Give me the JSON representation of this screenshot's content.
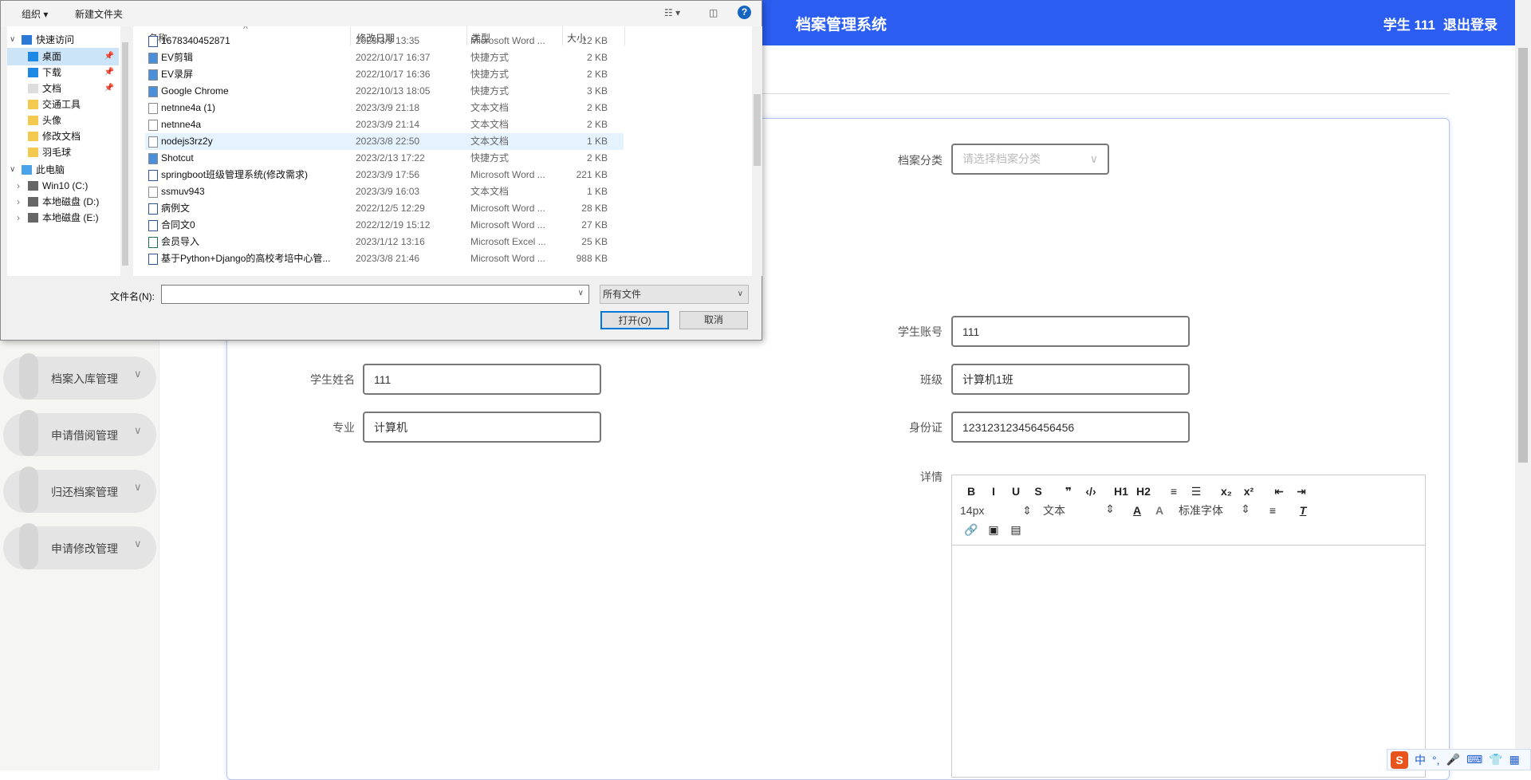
{
  "header": {
    "title": "档案管理系统",
    "user": "学生 111",
    "logout": "退出登录"
  },
  "sidebar": {
    "items": [
      {
        "label": "档案入库管理"
      },
      {
        "label": "申请借阅管理"
      },
      {
        "label": "归还档案管理"
      },
      {
        "label": "申请修改管理"
      }
    ]
  },
  "form": {
    "category": {
      "label": "档案分类",
      "placeholder": "请选择档案分类"
    },
    "account": {
      "label": "学生账号",
      "value": "111"
    },
    "name": {
      "label": "学生姓名",
      "value": "111"
    },
    "class": {
      "label": "班级",
      "value": "计算机1班"
    },
    "major": {
      "label": "专业",
      "value": "计算机"
    },
    "idcard": {
      "label": "身份证",
      "value": "123123123456456456"
    },
    "detail": {
      "label": "详情"
    }
  },
  "editor": {
    "row1": [
      "B",
      "I",
      "U",
      "S",
      "❞",
      "‹/›",
      "H1",
      "H2",
      "≡",
      "☰",
      "x₂",
      "x²",
      "⇤",
      "⇥"
    ],
    "size": "14px",
    "header": "文本",
    "font": "标准字体",
    "row3": [
      "🔗",
      "▣",
      "▤"
    ]
  },
  "dialog": {
    "organize": "组织 ▾",
    "new_folder": "新建文件夹",
    "nav": [
      {
        "label": "快速访问",
        "icon": "star-icon"
      },
      {
        "label": "桌面",
        "icon": "desktop-icon",
        "pinned": true
      },
      {
        "label": "下载",
        "icon": "download-icon",
        "pinned": true
      },
      {
        "label": "文档",
        "icon": "document-icon",
        "pinned": true
      },
      {
        "label": "交通工具",
        "icon": "folder-icon"
      },
      {
        "label": "头像",
        "icon": "folder-icon"
      },
      {
        "label": "修改文档",
        "icon": "folder-icon"
      },
      {
        "label": "羽毛球",
        "icon": "folder-icon"
      },
      {
        "label": "此电脑",
        "icon": "computer-icon"
      },
      {
        "label": "Win10 (C:)",
        "icon": "drive-icon"
      },
      {
        "label": "本地磁盘 (D:)",
        "icon": "drive-icon"
      },
      {
        "label": "本地磁盘 (E:)",
        "icon": "drive-icon"
      }
    ],
    "columns": [
      "名称",
      "修改日期",
      "类型",
      "大小"
    ],
    "files": [
      [
        "1678340452871",
        "2023/3/9 13:35",
        "Microsoft Word ...",
        "12 KB"
      ],
      [
        "EV剪辑",
        "2022/10/17 16:37",
        "快捷方式",
        "2 KB"
      ],
      [
        "EV录屏",
        "2022/10/17 16:36",
        "快捷方式",
        "2 KB"
      ],
      [
        "Google Chrome",
        "2022/10/13 18:05",
        "快捷方式",
        "3 KB"
      ],
      [
        "netnne4a (1)",
        "2023/3/9 21:18",
        "文本文档",
        "2 KB"
      ],
      [
        "netnne4a",
        "2023/3/9 21:14",
        "文本文档",
        "2 KB"
      ],
      [
        "nodejs3rz2y",
        "2023/3/8 22:50",
        "文本文档",
        "1 KB"
      ],
      [
        "Shotcut",
        "2023/2/13 17:22",
        "快捷方式",
        "2 KB"
      ],
      [
        "springboot班级管理系统(修改需求)",
        "2023/3/9 17:56",
        "Microsoft Word ...",
        "221 KB"
      ],
      [
        "ssmuv943",
        "2023/3/9 16:03",
        "文本文档",
        "1 KB"
      ],
      [
        "病例文",
        "2022/12/5 12:29",
        "Microsoft Word ...",
        "28 KB"
      ],
      [
        "合同文0",
        "2022/12/19 15:12",
        "Microsoft Word ...",
        "27 KB"
      ],
      [
        "会员导入",
        "2023/1/12 13:16",
        "Microsoft Excel ...",
        "25 KB"
      ],
      [
        "基于Python+Django的高校考培中心管...",
        "2023/3/8 21:46",
        "Microsoft Word ...",
        "988 KB"
      ]
    ],
    "filename_label": "文件名(N):",
    "filename_value": "",
    "filter": "所有文件",
    "open": "打开(O)",
    "cancel": "取消"
  },
  "ime": {
    "mode": "中",
    "punct": "°,"
  },
  "colors": {
    "accent": "#2a5df0"
  }
}
